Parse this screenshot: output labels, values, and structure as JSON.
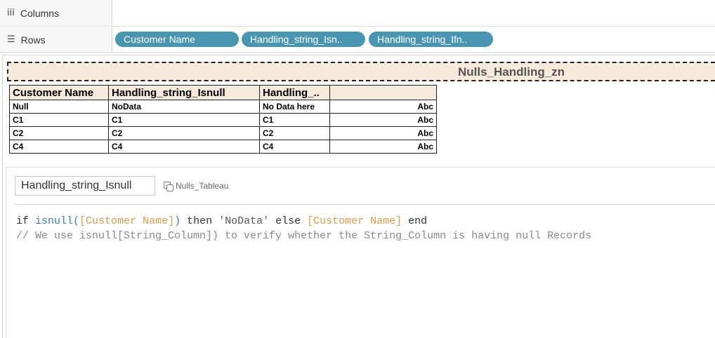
{
  "shelves": {
    "columns_label": "Columns",
    "columns_icon": "iii",
    "rows_label": "Rows",
    "rows_icon": "☰",
    "row_pills": [
      "Customer Name",
      "Handling_string_Isn..",
      "Handling_string_Ifn.."
    ]
  },
  "view": {
    "title": "Nulls_Handling_zn",
    "headers": [
      "Customer Name",
      "Handling_string_Isnull",
      "Handling_..",
      ""
    ],
    "rows": [
      [
        "Null",
        "NoData",
        "No Data here",
        "Abc"
      ],
      [
        "C1",
        "C1",
        "C1",
        "Abc"
      ],
      [
        "C2",
        "C2",
        "C2",
        "Abc"
      ],
      [
        "C4",
        "C4",
        "C4",
        "Abc"
      ]
    ]
  },
  "calc": {
    "name": "Handling_string_Isnull",
    "datasource": "Nulls_Tableau",
    "line1": {
      "if": "if ",
      "isnull": "isnull",
      "paren_open": "(",
      "field1": "[Customer Name]",
      "paren_close": ")",
      "then": " then ",
      "string": "'NoData'",
      "else": " else ",
      "field2": "[Customer Name]",
      "end": " end"
    },
    "line2": "// We use isnull[String_Column]) to verify whether the String_Column is having null Records"
  },
  "colors": {
    "pill": "#4996b2",
    "header_bg": "#f5eadb",
    "field": "#e39a4a",
    "function": "#3d7fa6"
  }
}
